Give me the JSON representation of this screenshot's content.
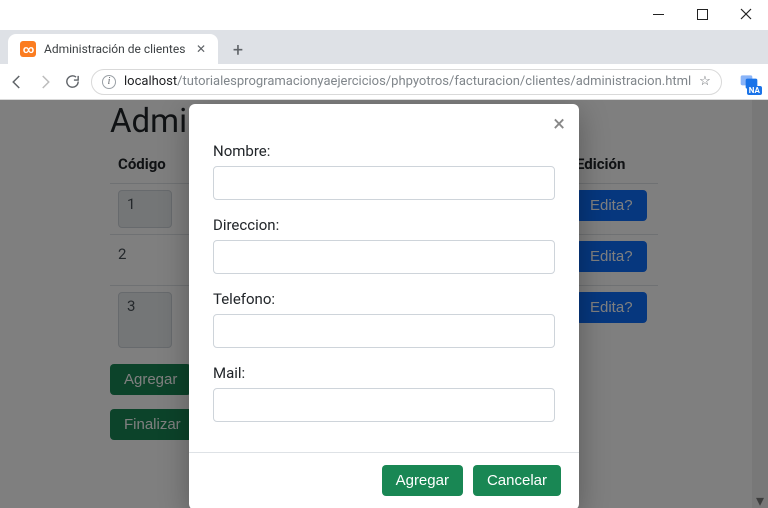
{
  "window": {
    "tab_title": "Administración de clientes",
    "url_host": "localhost",
    "url_path": "/tutorialesprogramacionyaejercicios/phpyotros/facturacion/clientes/administracion.html",
    "ext_badge": "NA"
  },
  "page": {
    "title": "Administracion de Clientes",
    "headers": {
      "codigo": "Código",
      "edicion": "Edición"
    },
    "rows": [
      {
        "code": "1",
        "edit": "Edita?"
      },
      {
        "code": "2",
        "edit": "Edita?"
      },
      {
        "code": "3",
        "edit": "Edita?"
      }
    ],
    "tall_hint": "e",
    "btn_agregar": "Agregar",
    "btn_finalizar": "Finalizar"
  },
  "modal": {
    "fields": {
      "nombre": "Nombre:",
      "direccion": "Direccion:",
      "telefono": "Telefono:",
      "mail": "Mail:"
    },
    "btn_agregar": "Agregar",
    "btn_cancelar": "Cancelar"
  }
}
